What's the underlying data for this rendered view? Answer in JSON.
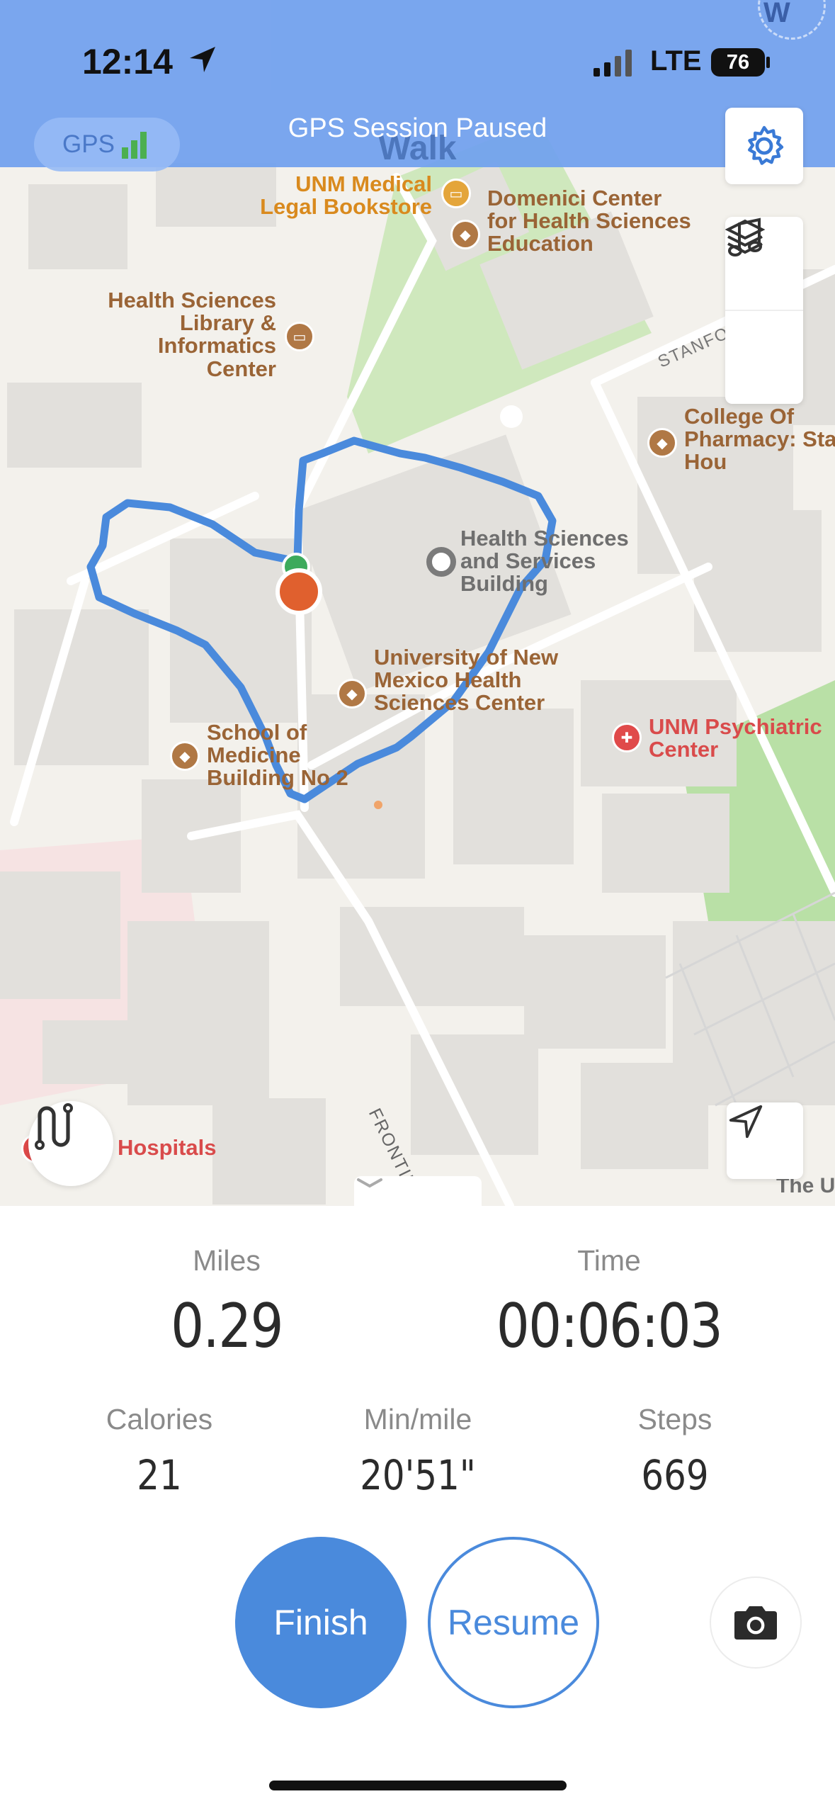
{
  "status_bar": {
    "time": "12:14",
    "network": "LTE",
    "battery": "76"
  },
  "header": {
    "gps_label": "GPS",
    "session_status": "GPS Session Paused",
    "activity_mode": "Walk",
    "compass_letter": "W"
  },
  "map": {
    "places": {
      "unm_bookstore": "UNM Medical Legal Bookstore",
      "domenici": "Domenici Center for Health Sciences Education",
      "library": "Health Sciences Library & Informatics Center",
      "pharmacy": "College Of Pharmacy: Stanford Hou",
      "hssb": "Health Sciences and Services Building",
      "unm_hsc": "University of New Mexico Health Sciences Center",
      "school_medicine": "School of Medicine Building No 2",
      "psychiatric": "UNM Psychiatric Center",
      "hospitals": "Hospitals",
      "the_u": "The U"
    },
    "streets": {
      "frontier": "FRONTIER AVE NE",
      "stanford": "STANFO"
    },
    "icons": [
      "gear-icon",
      "music-icon",
      "layers-icon",
      "route-icon",
      "locate-arrow-icon",
      "chevron-down-icon"
    ]
  },
  "stats": {
    "miles": {
      "label": "Miles",
      "value": "0.29"
    },
    "time": {
      "label": "Time",
      "value": "00:06:03"
    },
    "calories": {
      "label": "Calories",
      "value": "21"
    },
    "pace": {
      "label": "Min/mile",
      "value": "20'51\""
    },
    "steps": {
      "label": "Steps",
      "value": "669"
    }
  },
  "actions": {
    "finish": "Finish",
    "resume": "Resume"
  },
  "colors": {
    "accent": "#4a8adc",
    "route": "#4a8adc",
    "current_position": "#e0602e",
    "start_marker": "#3daa5c"
  }
}
